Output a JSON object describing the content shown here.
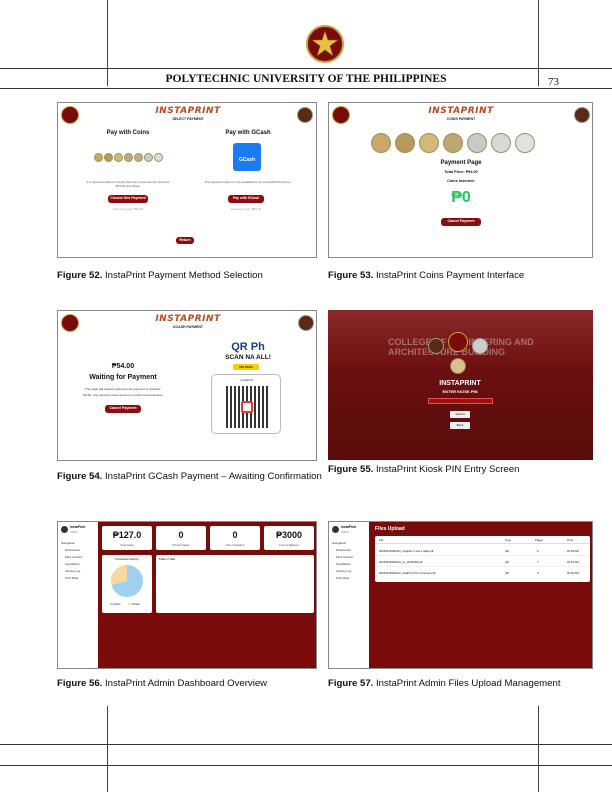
{
  "header": {
    "university": "POLYTECHNIC UNIVERSITY OF THE PHILIPPINES",
    "page_number": "73"
  },
  "figures": [
    {
      "label": "Figure 52.",
      "caption": " InstaPrint Payment Method Selection"
    },
    {
      "label": "Figure 53.",
      "caption": " InstaPrint Coins Payment Interface"
    },
    {
      "label": "Figure 54.",
      "caption": " InstaPrint GCash Payment – Awaiting Confirmation"
    },
    {
      "label": "Figure 55.",
      "caption": " InstaPrint Kiosk PIN Entry Screen"
    },
    {
      "label": "Figure 56.",
      "caption": " InstaPrint Admin Dashboard Overview"
    },
    {
      "label": "Figure 57.",
      "caption": " InstaPrint Admin Files Upload Management"
    }
  ],
  "fig52": {
    "brand": "INSTAPRINT",
    "subtitle": "SELECT PAYMENT",
    "coins_title": "Pay with Coins",
    "gcash_title": "Pay with GCash",
    "gcash_logo": "GCash",
    "coins_note": "It is recommended to choose this type of payment for amounts ₱15.00 and below.",
    "gcash_note": "This payment option is only available for amounts ₱20.00 and up.",
    "coins_button": "Choose this Payment",
    "gcash_button": "Pay with GCash",
    "coins_small": "Amount to pay: ₱54.00",
    "gcash_small": "Amount to pay: ₱54.00",
    "return_button": "Return"
  },
  "fig53": {
    "brand": "INSTAPRINT",
    "subtitle": "COINS PAYMENT",
    "page_title": "Payment Page",
    "total_price": "Total Price: ₱54.00",
    "coins_inserted": "Coins Inserted:",
    "amount": "₱0",
    "cancel_button": "Cancel Payment"
  },
  "fig54": {
    "brand": "INSTAPRINT",
    "subtitle": "GCASH PAYMENT",
    "amount": "₱54.00",
    "status": "Waiting for Payment",
    "note1": "This page will redirect whenever the payment is received.",
    "note2": "NOTE: only send the exact amount to avoid inconveniences.",
    "cancel_button": "Cancel Payment",
    "qr_brand": "QR Ph",
    "qr_tag": "SCAN NA ALL!",
    "qr_badge": "NO FEES",
    "qr_merchant": "InstaPrint"
  },
  "fig55": {
    "bg_text": "COLLEGE OF ENGINEERING AND ARCHITECTURE BUILDING",
    "brand": "INSTAPRINT",
    "prompt": "ENTER KIOSK PIN",
    "submit_button": "Submit",
    "back_button": "Back"
  },
  "fig56": {
    "user": "InstaPrint",
    "role": "Admin",
    "nav_heading": "Navigation",
    "nav": [
      "Dashboard",
      "Files Upload",
      "Feedbacks",
      "Activity Log",
      "Print Rate"
    ],
    "stats": [
      {
        "value": "₱127.0",
        "label": "Total Sales"
      },
      {
        "value": "0",
        "label": "Printed Pages"
      },
      {
        "value": "0",
        "label": "Files Uploaded"
      },
      {
        "value": "₱3000",
        "label": "Current Balance"
      }
    ],
    "chart_title": "Transaction History",
    "legend": [
      "Coins",
      "GCash"
    ],
    "table_title": "Table of Sale"
  },
  "fig57": {
    "user": "InstaPrint",
    "role": "Admin",
    "nav_heading": "Navigation",
    "nav": [
      "Dashboard",
      "Files Upload",
      "Feedbacks",
      "Activity Log",
      "Print Rate"
    ],
    "title": "Files Upload",
    "columns": [
      "File",
      "Type",
      "Pages",
      "Time"
    ],
    "rows": [
      [
        "20240510202421_Chapter 1 and 2 data.pdf",
        "pdf",
        "5",
        "02:46 AM"
      ],
      [
        "20240510200012_Ioi_2024198.pdf",
        "pdf",
        "7",
        "02:44 AM"
      ],
      [
        "20240510202012_finalPrint The Universe.pdf",
        "pdf",
        "9",
        "02:46 AM"
      ]
    ]
  },
  "colors": {
    "maroon": "#7a0b0b",
    "gold": "#caa23a",
    "gcash_blue": "#1a7cf0",
    "green": "#22c55e"
  }
}
